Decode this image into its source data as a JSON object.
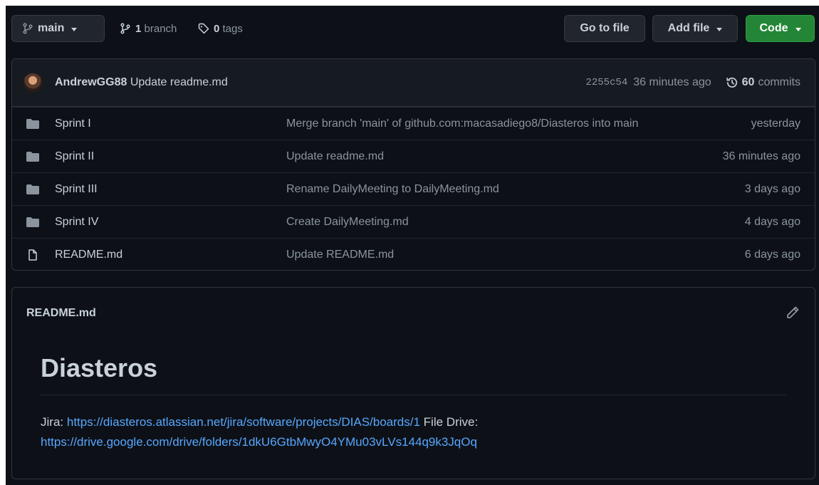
{
  "toolbar": {
    "branch_name": "main",
    "branches_count": "1",
    "branches_label": "branch",
    "tags_count": "0",
    "tags_label": "tags",
    "goto_file_label": "Go to file",
    "add_file_label": "Add file",
    "code_label": "Code"
  },
  "latest_commit": {
    "author": "AndrewGG88",
    "message": "Update readme.md",
    "sha": "2255c54",
    "time": "36 minutes ago",
    "commits_count": "60",
    "commits_label": "commits"
  },
  "files": [
    {
      "type": "folder",
      "name": "Sprint I",
      "message": "Merge branch 'main' of github.com:macasadiego8/Diasteros into main",
      "age": "yesterday"
    },
    {
      "type": "folder",
      "name": "Sprint II",
      "message": "Update readme.md",
      "age": "36 minutes ago"
    },
    {
      "type": "folder",
      "name": "Sprint III",
      "message": "Rename DailyMeeting to DailyMeeting.md",
      "age": "3 days ago"
    },
    {
      "type": "folder",
      "name": "Sprint IV",
      "message": "Create DailyMeeting.md",
      "age": "4 days ago"
    },
    {
      "type": "file",
      "name": "README.md",
      "message": "Update README.md",
      "age": "6 days ago"
    }
  ],
  "readme": {
    "filename": "README.md",
    "heading": "Diasteros",
    "jira_label": "Jira:",
    "jira_url": "https://diasteros.atlassian.net/jira/software/projects/DIAS/boards/1",
    "drive_label": "File Drive:",
    "drive_url": "https://drive.google.com/drive/folders/1dkU6GtbMwyO4YMu03vLVs144q9k3JqOq"
  },
  "colors": {
    "background": "#0d1117",
    "text": "#c9d1d9",
    "muted": "#8b949e",
    "link": "#58a6ff",
    "code_button": "#238636"
  }
}
